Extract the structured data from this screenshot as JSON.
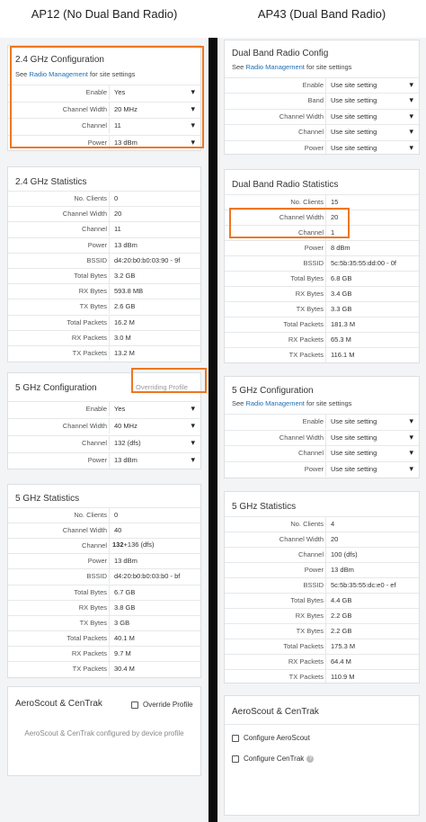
{
  "left": {
    "heading": "AP12 (No Dual Band Radio)",
    "cfg24": {
      "title": "2.4 GHz Configuration",
      "note_prefix": "See ",
      "note_link": "Radio Management",
      "note_suffix": " for site settings",
      "rows": [
        {
          "label": "Enable",
          "value": "Yes"
        },
        {
          "label": "Channel Width",
          "value": "20 MHz"
        },
        {
          "label": "Channel",
          "value": "11"
        },
        {
          "label": "Power",
          "value": "13 dBm"
        }
      ]
    },
    "stats24": {
      "title": "2.4 GHz Statistics",
      "rows": [
        {
          "label": "No. Clients",
          "value": "0"
        },
        {
          "label": "Channel Width",
          "value": "20"
        },
        {
          "label": "Channel",
          "value": "11"
        },
        {
          "label": "Power",
          "value": "13 dBm"
        },
        {
          "label": "BSSID",
          "value": "d4:20:b0:b0:03:90 - 9f"
        },
        {
          "label": "Total Bytes",
          "value": "3.2 GB"
        },
        {
          "label": "RX Bytes",
          "value": "593.8 MB"
        },
        {
          "label": "TX Bytes",
          "value": "2.6 GB"
        },
        {
          "label": "Total Packets",
          "value": "16.2 M"
        },
        {
          "label": "RX Packets",
          "value": "3.0 M"
        },
        {
          "label": "TX Packets",
          "value": "13.2 M"
        }
      ]
    },
    "cfg5": {
      "title": "5 GHz Configuration",
      "override": "Overriding Profile",
      "rows": [
        {
          "label": "Enable",
          "value": "Yes"
        },
        {
          "label": "Channel Width",
          "value": "40 MHz"
        },
        {
          "label": "Channel",
          "value": "132 (dfs)"
        },
        {
          "label": "Power",
          "value": "13 dBm"
        }
      ]
    },
    "stats5": {
      "title": "5 GHz Statistics",
      "channel_bold": "132",
      "channel_rest": "+136 (dfs)",
      "rows": [
        {
          "label": "No. Clients",
          "value": "0"
        },
        {
          "label": "Channel Width",
          "value": "40"
        },
        {
          "label": "Channel",
          "value": ""
        },
        {
          "label": "Power",
          "value": "13 dBm"
        },
        {
          "label": "BSSID",
          "value": "d4:20:b0:b0:03:b0 - bf"
        },
        {
          "label": "Total Bytes",
          "value": "6.7 GB"
        },
        {
          "label": "RX Bytes",
          "value": "3.8 GB"
        },
        {
          "label": "TX Bytes",
          "value": "3 GB"
        },
        {
          "label": "Total Packets",
          "value": "40.1 M"
        },
        {
          "label": "RX Packets",
          "value": "9.7 M"
        },
        {
          "label": "TX Packets",
          "value": "30.4 M"
        }
      ]
    },
    "aero": {
      "title": "AeroScout & CenTrak",
      "override_label": "Override Profile",
      "note": "AeroScout & CenTrak configured by device profile"
    }
  },
  "right": {
    "heading": "AP43 (Dual Band Radio)",
    "dbcfg": {
      "title": "Dual Band Radio Config",
      "note_prefix": "See ",
      "note_link": "Radio Management",
      "note_suffix": " for site settings",
      "rows": [
        {
          "label": "Enable",
          "value": "Use site setting"
        },
        {
          "label": "Band",
          "value": "Use site setting"
        },
        {
          "label": "Channel Width",
          "value": "Use site setting"
        },
        {
          "label": "Channel",
          "value": "Use site setting"
        },
        {
          "label": "Power",
          "value": "Use site setting"
        }
      ]
    },
    "dbstats": {
      "title": "Dual Band Radio Statistics",
      "rows": [
        {
          "label": "No. Clients",
          "value": "15"
        },
        {
          "label": "Channel Width",
          "value": "20"
        },
        {
          "label": "Channel",
          "value": "1"
        },
        {
          "label": "Power",
          "value": "8 dBm"
        },
        {
          "label": "BSSID",
          "value": "5c:5b:35:55:dd:00 - 0f"
        },
        {
          "label": "Total Bytes",
          "value": "6.8 GB"
        },
        {
          "label": "RX Bytes",
          "value": "3.4 GB"
        },
        {
          "label": "TX Bytes",
          "value": "3.3 GB"
        },
        {
          "label": "Total Packets",
          "value": "181.3 M"
        },
        {
          "label": "RX Packets",
          "value": "65.3 M"
        },
        {
          "label": "TX Packets",
          "value": "116.1 M"
        }
      ]
    },
    "cfg5": {
      "title": "5 GHz Configuration",
      "note_prefix": "See ",
      "note_link": "Radio Management",
      "note_suffix": " for site settings",
      "rows": [
        {
          "label": "Enable",
          "value": "Use site setting"
        },
        {
          "label": "Channel Width",
          "value": "Use site setting"
        },
        {
          "label": "Channel",
          "value": "Use site setting"
        },
        {
          "label": "Power",
          "value": "Use site setting"
        }
      ]
    },
    "stats5": {
      "title": "5 GHz Statistics",
      "rows": [
        {
          "label": "No. Clients",
          "value": "4"
        },
        {
          "label": "Channel Width",
          "value": "20"
        },
        {
          "label": "Channel",
          "value": "100 (dfs)"
        },
        {
          "label": "Power",
          "value": "13 dBm"
        },
        {
          "label": "BSSID",
          "value": "5c:5b:35:55:dc:e0 - ef"
        },
        {
          "label": "Total Bytes",
          "value": "4.4 GB"
        },
        {
          "label": "RX Bytes",
          "value": "2.2 GB"
        },
        {
          "label": "TX Bytes",
          "value": "2.2 GB"
        },
        {
          "label": "Total Packets",
          "value": "175.3 M"
        },
        {
          "label": "RX Packets",
          "value": "64.4 M"
        },
        {
          "label": "TX Packets",
          "value": "110.9 M"
        }
      ]
    },
    "aero": {
      "title": "AeroScout & CenTrak",
      "configure_aeroscout": "Configure AeroScout",
      "configure_centrak": "Configure CenTrak",
      "help_glyph": "?"
    }
  },
  "colors": {
    "highlight": "#ee7622",
    "link": "#1e6fb5",
    "divider": "#0d0d0d"
  }
}
